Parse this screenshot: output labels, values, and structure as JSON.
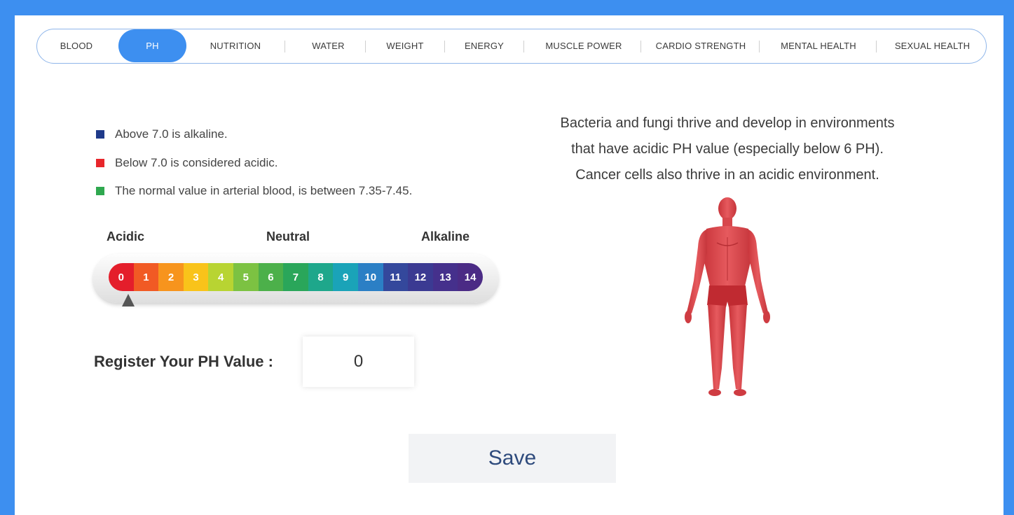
{
  "tabs": [
    {
      "label": "BLOOD",
      "active": false
    },
    {
      "label": "PH",
      "active": true
    },
    {
      "label": "NUTRITION",
      "active": false
    },
    {
      "label": "WATER",
      "active": false
    },
    {
      "label": "WEIGHT",
      "active": false
    },
    {
      "label": "ENERGY",
      "active": false
    },
    {
      "label": "MUSCLE POWER",
      "active": false
    },
    {
      "label": "CARDIO STRENGTH",
      "active": false
    },
    {
      "label": "MENTAL HEALTH",
      "active": false
    },
    {
      "label": "SEXUAL HEALTH",
      "active": false
    }
  ],
  "legend": [
    {
      "text": "Above 7.0 is alkaline.",
      "color": "#1f3a8a"
    },
    {
      "text": "Below 7.0 is considered acidic.",
      "color": "#e8262b"
    },
    {
      "text": "The normal value in arterial blood, is between 7.35-7.45.",
      "color": "#2fa84f"
    }
  ],
  "scale": {
    "labels": {
      "acidic": "Acidic",
      "neutral": "Neutral",
      "alkaline": "Alkaline"
    },
    "cells": [
      "0",
      "1",
      "2",
      "3",
      "4",
      "5",
      "6",
      "7",
      "8",
      "9",
      "10",
      "11",
      "12",
      "13",
      "14"
    ],
    "colors": [
      "#e41e2b",
      "#f15a24",
      "#f7941d",
      "#f9c31a",
      "#b8d432",
      "#7cc242",
      "#4cb04a",
      "#2aa65a",
      "#1ea78b",
      "#1aa3b8",
      "#2b7fc5",
      "#34489c",
      "#3b3a92",
      "#45308c",
      "#4b2b85"
    ],
    "pointer_value": 0
  },
  "register": {
    "label": "Register Your PH Value :",
    "value": "0"
  },
  "save_label": "Save",
  "info_lines": [
    "Bacteria and fungi thrive and develop in environments",
    "that have acidic PH value (especially below 6 PH).",
    "Cancer cells also thrive in an acidic environment."
  ],
  "accent_color": "#3d8ff0"
}
